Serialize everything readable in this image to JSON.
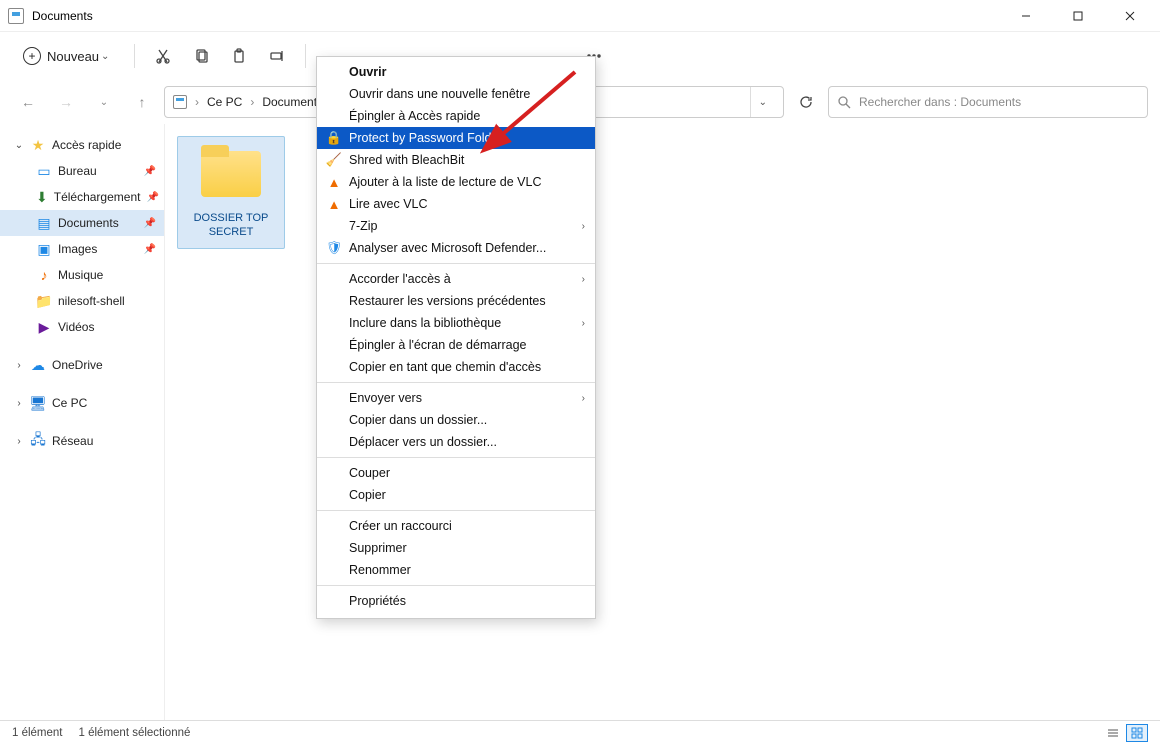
{
  "window": {
    "title": "Documents"
  },
  "toolbar": {
    "new_label": "Nouveau"
  },
  "breadcrumb": {
    "root": "Ce PC",
    "current": "Documents"
  },
  "search": {
    "placeholder": "Rechercher dans : Documents"
  },
  "sidebar": {
    "quick_access": "Accès rapide",
    "items": [
      {
        "label": "Bureau"
      },
      {
        "label": "Téléchargement"
      },
      {
        "label": "Documents"
      },
      {
        "label": "Images"
      },
      {
        "label": "Musique"
      },
      {
        "label": "nilesoft-shell"
      },
      {
        "label": "Vidéos"
      }
    ],
    "onedrive": "OneDrive",
    "this_pc": "Ce PC",
    "network": "Réseau"
  },
  "content": {
    "selected_item_label": "DOSSIER TOP SECRET"
  },
  "context_menu": {
    "open": "Ouvrir",
    "open_new_window": "Ouvrir dans une nouvelle fenêtre",
    "pin_quick": "Épingler à Accès rapide",
    "protect_pwd": "Protect by Password Folder",
    "shred": "Shred with BleachBit",
    "vlc_add": "Ajouter à la liste de lecture de VLC",
    "vlc_play": "Lire avec VLC",
    "sevenzip": "7-Zip",
    "defender": "Analyser avec Microsoft Defender...",
    "grant_access": "Accorder l'accès à",
    "restore_versions": "Restaurer les versions précédentes",
    "include_library": "Inclure dans la bibliothèque",
    "pin_start": "Épingler à l'écran de démarrage",
    "copy_path": "Copier en tant que chemin d'accès",
    "send_to": "Envoyer vers",
    "copy_to_folder": "Copier dans un dossier...",
    "move_to_folder": "Déplacer vers un dossier...",
    "cut": "Couper",
    "copy": "Copier",
    "shortcut": "Créer un raccourci",
    "delete": "Supprimer",
    "rename": "Renommer",
    "properties": "Propriétés"
  },
  "status": {
    "count": "1 élément",
    "selected": "1 élément sélectionné"
  }
}
